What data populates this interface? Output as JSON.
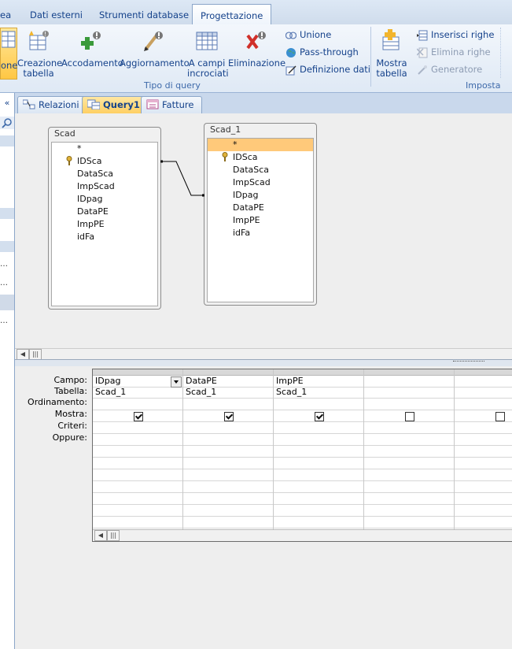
{
  "ribbon": {
    "tabs": [
      {
        "label": "ea"
      },
      {
        "label": "Dati esterni"
      },
      {
        "label": "Strumenti database"
      },
      {
        "label": "Progettazione",
        "active": true
      }
    ],
    "buttons": {
      "partial": "one",
      "creazione_line1": "Creazione",
      "creazione_line2": "tabella",
      "accodamento": "Accodamento",
      "aggiornamento": "Aggiornamento",
      "acampi_line1": "A campi",
      "acampi_line2": "incrociati",
      "eliminazione": "Eliminazione",
      "unione": "Unione",
      "pass_through": "Pass-through",
      "definizione_dati": "Definizione dati",
      "mostra_line1": "Mostra",
      "mostra_line2": "tabella",
      "inserisci_righe": "Inserisci righe",
      "elimina_righe": "Elimina righe",
      "generatore": "Generatore"
    },
    "groups": {
      "tipo_query": "Tipo di query",
      "imposta": "Imposta qu"
    }
  },
  "doctabs": [
    {
      "label": "Relazioni"
    },
    {
      "label": "Query1",
      "active": true
    },
    {
      "label": "Fatture"
    }
  ],
  "tables": [
    {
      "title": "Scad",
      "fields": [
        "*",
        "IDSca",
        "DataSca",
        "ImpScad",
        "IDpag",
        "DataPE",
        "ImpPE",
        "idFa"
      ]
    },
    {
      "title": "Scad_1",
      "fields": [
        "*",
        "IDSca",
        "DataSca",
        "ImpScad",
        "IDpag",
        "DataPE",
        "ImpPE",
        "idFa"
      ]
    }
  ],
  "grid": {
    "row_labels": [
      "Campo:",
      "Tabella:",
      "Ordinamento:",
      "Mostra:",
      "Criteri:",
      "Oppure:"
    ],
    "columns": [
      {
        "campo": "IDpag",
        "tabella": "Scad_1",
        "mostra": true
      },
      {
        "campo": "DataPE",
        "tabella": "Scad_1",
        "mostra": true
      },
      {
        "campo": "ImpPE",
        "tabella": "Scad_1",
        "mostra": true
      },
      {
        "campo": "",
        "tabella": "",
        "mostra": false
      },
      {
        "campo": "",
        "tabella": "",
        "mostra": false
      }
    ]
  },
  "icons": [
    "datasheet-icon",
    "create-table-icon",
    "append-icon",
    "update-icon",
    "crosstab-icon",
    "delete-icon",
    "union-icon",
    "pass-through-icon",
    "data-definition-icon",
    "show-table-icon",
    "insert-rows-icon",
    "delete-rows-icon",
    "builder-icon",
    "key-icon",
    "dropdown-arrow-icon"
  ],
  "colors": {
    "active_tab": "#ffcf62",
    "selected_field": "#ffc97a",
    "ribbon_text": "#15428b"
  }
}
